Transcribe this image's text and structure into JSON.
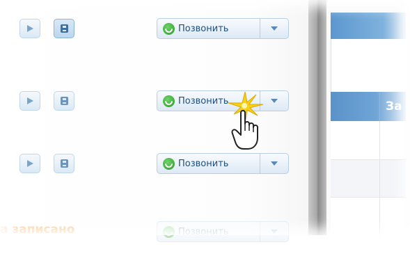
{
  "rows": [
    {
      "call_label": "Позвонить"
    },
    {
      "call_label": "Позвонить"
    },
    {
      "call_label": "Позвонить"
    },
    {
      "call_label": "Позвонить"
    }
  ],
  "status_text": "а записано",
  "right_panel": {
    "column_header": "За"
  },
  "icons": [
    "play-icon",
    "save-icon",
    "phone-icon",
    "chevron-down-icon",
    "hand-pointer-icon"
  ],
  "colors": {
    "accent_blue": "#5a93c9",
    "call_green": "#2c9a2a",
    "status_orange": "#f39a3d"
  }
}
